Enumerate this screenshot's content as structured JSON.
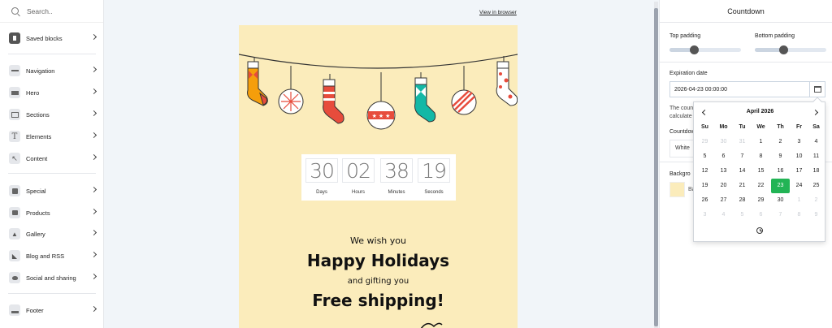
{
  "search": {
    "placeholder": "Search.."
  },
  "sidebar": {
    "items": [
      {
        "label": "Saved blocks"
      },
      {
        "label": "Navigation"
      },
      {
        "label": "Hero"
      },
      {
        "label": "Sections"
      },
      {
        "label": "Elements"
      },
      {
        "label": "Content"
      },
      {
        "label": "Special"
      },
      {
        "label": "Products"
      },
      {
        "label": "Gallery"
      },
      {
        "label": "Blog and RSS"
      },
      {
        "label": "Social and sharing"
      },
      {
        "label": "Footer"
      }
    ]
  },
  "canvas": {
    "view_link": "View in browser",
    "countdown": {
      "days": "30",
      "hours": "02",
      "minutes": "38",
      "seconds": "19",
      "labels": {
        "days": "Days",
        "hours": "Hours",
        "minutes": "Minutes",
        "seconds": "Seconds"
      }
    },
    "line1": "We wish you",
    "line2": "Happy Holidays",
    "line3": "and gifting you",
    "line4": "Free shipping!"
  },
  "panel": {
    "title": "Countdown",
    "top_padding_label": "Top padding",
    "top_padding_level": 0.35,
    "bottom_padding_label": "Bottom padding",
    "bottom_padding_level": 0.4,
    "expiration_label": "Expiration date",
    "expiration_value": "2026-04-23 00:00:00",
    "note_partial_1": "The coun",
    "note_partial_2": "calculate",
    "countdown_style_partial": "Countdow",
    "style_value": "White",
    "background_partial": "Backgro",
    "background_value_partial": "Ba"
  },
  "datepicker": {
    "month_label": "April 2026",
    "weekdays": [
      "Su",
      "Mo",
      "Tu",
      "We",
      "Th",
      "Fr",
      "Sa"
    ],
    "weeks": [
      [
        {
          "d": "29",
          "m": true
        },
        {
          "d": "30",
          "m": true
        },
        {
          "d": "31",
          "m": true
        },
        {
          "d": "1"
        },
        {
          "d": "2"
        },
        {
          "d": "3"
        },
        {
          "d": "4"
        }
      ],
      [
        {
          "d": "5"
        },
        {
          "d": "6"
        },
        {
          "d": "7"
        },
        {
          "d": "8"
        },
        {
          "d": "9"
        },
        {
          "d": "10"
        },
        {
          "d": "11"
        }
      ],
      [
        {
          "d": "12"
        },
        {
          "d": "13"
        },
        {
          "d": "14"
        },
        {
          "d": "15"
        },
        {
          "d": "16"
        },
        {
          "d": "17"
        },
        {
          "d": "18"
        }
      ],
      [
        {
          "d": "19"
        },
        {
          "d": "20"
        },
        {
          "d": "21"
        },
        {
          "d": "22"
        },
        {
          "d": "23",
          "sel": true
        },
        {
          "d": "24"
        },
        {
          "d": "25"
        }
      ],
      [
        {
          "d": "26"
        },
        {
          "d": "27"
        },
        {
          "d": "28"
        },
        {
          "d": "29"
        },
        {
          "d": "30"
        },
        {
          "d": "1",
          "m": true
        },
        {
          "d": "2",
          "m": true
        }
      ],
      [
        {
          "d": "3",
          "m": true
        },
        {
          "d": "4",
          "m": true
        },
        {
          "d": "5",
          "m": true
        },
        {
          "d": "6",
          "m": true
        },
        {
          "d": "7",
          "m": true
        },
        {
          "d": "8",
          "m": true
        },
        {
          "d": "9",
          "m": true
        }
      ]
    ],
    "selected_color": "#22b455"
  },
  "colors": {
    "email_bg": "#fbecbb",
    "accent": "#22b455"
  }
}
